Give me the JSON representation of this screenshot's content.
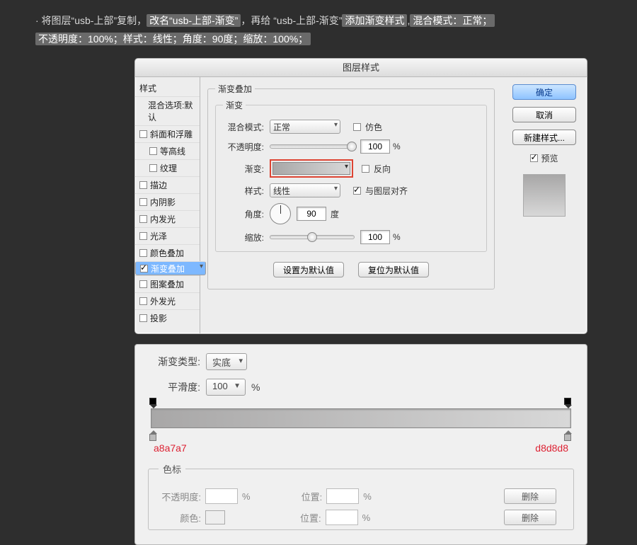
{
  "instruction": {
    "pre": "· 将图层“usb-上部”复制，",
    "hl1": "改名“usb-上部-渐变”",
    "mid1": "，再给 “usb-上部-渐变”",
    "hl2": "添加渐变样式",
    "mid2": ",",
    "hl3": "混合模式：正常；",
    "hl4": "不透明度：100%；样式：线性；角度：90度；缩放：100%；"
  },
  "dialog": {
    "title": "图层样式"
  },
  "sidebar": {
    "hdr": "样式",
    "blend": "混合选项:默认",
    "items": [
      {
        "label": "斜面和浮雕",
        "chk": false
      },
      {
        "label": "等高线",
        "chk": false,
        "indent": true
      },
      {
        "label": "纹理",
        "chk": false,
        "indent": true
      },
      {
        "label": "描边",
        "chk": false
      },
      {
        "label": "内阴影",
        "chk": false
      },
      {
        "label": "内发光",
        "chk": false
      },
      {
        "label": "光泽",
        "chk": false
      },
      {
        "label": "颜色叠加",
        "chk": false
      },
      {
        "label": "渐变叠加",
        "chk": true,
        "sel": true
      },
      {
        "label": "图案叠加",
        "chk": false
      },
      {
        "label": "外发光",
        "chk": false
      },
      {
        "label": "投影",
        "chk": false
      }
    ]
  },
  "group": {
    "legend": "渐变叠加",
    "inner_legend": "渐变",
    "blend_label": "混合模式:",
    "blend_value": "正常",
    "dither_label": "仿色",
    "opacity_label": "不透明度:",
    "opacity_value": "100",
    "pct": "%",
    "gradient_label": "渐变:",
    "reverse_label": "反向",
    "style_label": "样式:",
    "style_value": "线性",
    "align_label": "与图层对齐",
    "angle_label": "角度:",
    "angle_value": "90",
    "angle_unit": "度",
    "scale_label": "缩放:",
    "scale_value": "100",
    "set_default": "设置为默认值",
    "reset_default": "复位为默认值"
  },
  "rightcol": {
    "ok": "确定",
    "cancel": "取消",
    "newstyle": "新建样式...",
    "preview": "预览"
  },
  "editor": {
    "type_label": "渐变类型:",
    "type_value": "实底",
    "smooth_label": "平滑度:",
    "smooth_value": "100",
    "pct": "%",
    "color_left": "a8a7a7",
    "color_right": "d8d8d8",
    "stops_legend": "色标",
    "opacity_label": "不透明度:",
    "pos_label": "位置:",
    "color_label": "颜色:",
    "delete": "删除"
  }
}
